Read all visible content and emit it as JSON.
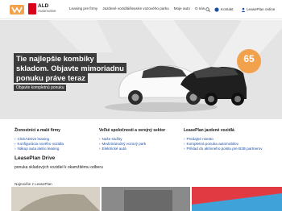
{
  "header": {
    "logo_main": "ALD",
    "logo_sub": "Automotive",
    "nav": [
      "Leasing pre firmy",
      "Jazdené vozidlá/lieasrie vozového parku",
      "Moje auto",
      "O nás"
    ],
    "contact_label": "Kontakt",
    "online_label": "LeasePlan online"
  },
  "hero": {
    "lines": [
      "Tie najlepšie kombiky",
      "skladom. Objavte mimoriadnu",
      "ponuku práve teraz"
    ],
    "cta": "Objavte kompletnú ponuku",
    "badge": "65"
  },
  "columns": [
    {
      "title": "Živnostníci a malé firmy",
      "items": [
        "ClickADrive leasing",
        "Konfigurácia nového vozidla",
        "Nákup auta alebo leasing"
      ]
    },
    {
      "title": "Veľké spoločnosti a verejný sektor",
      "items": [
        "Naše služby",
        "Medzinárodný vozový park",
        "Elektrické autá"
      ]
    },
    {
      "title": "LeasePlan jazdené vozidlá",
      "items": [
        "Predajné miesto",
        "Kompletná ponuka automobilov",
        "Príklad do aktívneho poistu pre B2B partnerov"
      ]
    }
  ],
  "drive": {
    "title": "LeasePlan Drive",
    "description": "ponuka skladových vozidiel k okamžitému odberu"
  },
  "news_label": "Najnovšie z LeasePlan",
  "colors": {
    "accent": "#d9001b",
    "orange": "#f2a14d",
    "link": "#1d4fa3",
    "hero_bg": "#e4e4e4"
  }
}
